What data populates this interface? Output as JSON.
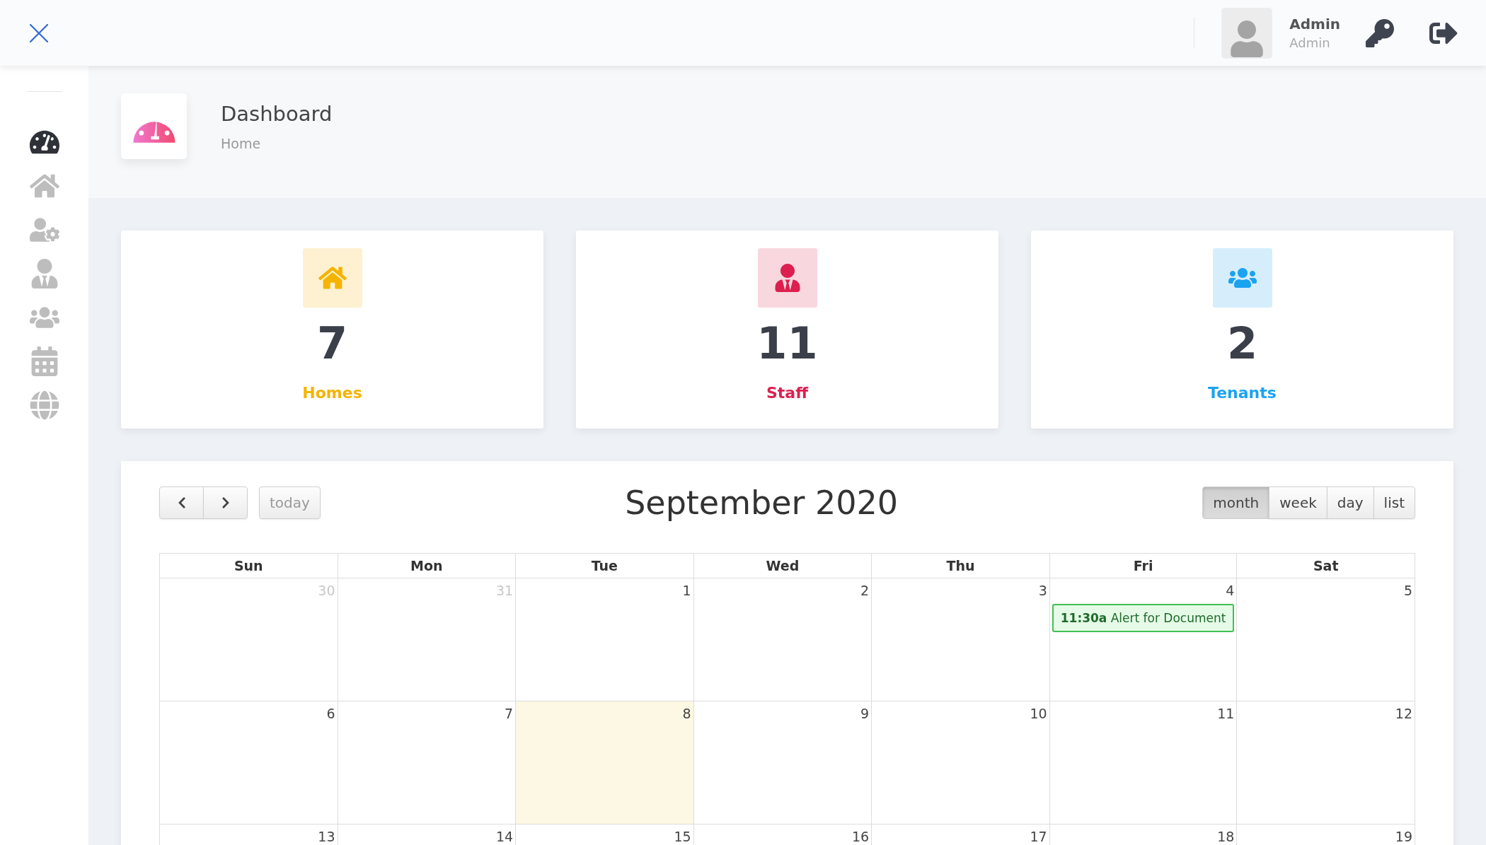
{
  "topbar": {
    "user_name": "Admin",
    "user_role": "Admin"
  },
  "sidebar": {
    "items": [
      {
        "kind": "dashboard",
        "selected": true
      },
      {
        "kind": "homes",
        "selected": false
      },
      {
        "kind": "user-settings",
        "selected": false
      },
      {
        "kind": "staff",
        "selected": false
      },
      {
        "kind": "tenants",
        "selected": false
      },
      {
        "kind": "calendar",
        "selected": false
      },
      {
        "kind": "globe",
        "selected": false
      }
    ]
  },
  "page_header": {
    "title": "Dashboard",
    "breadcrumb": "Home"
  },
  "stats": [
    {
      "kind": "homes",
      "value": "7",
      "label": "Homes",
      "color": "#f5b400"
    },
    {
      "kind": "staff",
      "value": "11",
      "label": "Staff",
      "color": "#dc1f4f"
    },
    {
      "kind": "tenants",
      "value": "2",
      "label": "Tenants",
      "color": "#1ba3f0"
    }
  ],
  "calendar": {
    "title": "September 2020",
    "today_button": "today",
    "views": [
      {
        "label": "month",
        "selected": true
      },
      {
        "label": "week",
        "selected": false
      },
      {
        "label": "day",
        "selected": false
      },
      {
        "label": "list",
        "selected": false
      }
    ],
    "weekdays": [
      "Sun",
      "Mon",
      "Tue",
      "Wed",
      "Thu",
      "Fri",
      "Sat"
    ],
    "weeks": [
      [
        {
          "day": "30",
          "other_month": true,
          "today": false
        },
        {
          "day": "31",
          "other_month": true,
          "today": false
        },
        {
          "day": "1",
          "other_month": false,
          "today": false
        },
        {
          "day": "2",
          "other_month": false,
          "today": false
        },
        {
          "day": "3",
          "other_month": false,
          "today": false
        },
        {
          "day": "4",
          "other_month": false,
          "today": false,
          "events": [
            {
              "time": "11:30a",
              "title": "Alert for Document"
            }
          ]
        },
        {
          "day": "5",
          "other_month": false,
          "today": false
        }
      ],
      [
        {
          "day": "6",
          "other_month": false,
          "today": false
        },
        {
          "day": "7",
          "other_month": false,
          "today": false
        },
        {
          "day": "8",
          "other_month": false,
          "today": true
        },
        {
          "day": "9",
          "other_month": false,
          "today": false
        },
        {
          "day": "10",
          "other_month": false,
          "today": false
        },
        {
          "day": "11",
          "other_month": false,
          "today": false
        },
        {
          "day": "12",
          "other_month": false,
          "today": false
        }
      ],
      [
        {
          "day": "13",
          "other_month": false,
          "today": false
        },
        {
          "day": "14",
          "other_month": false,
          "today": false
        },
        {
          "day": "15",
          "other_month": false,
          "today": false
        },
        {
          "day": "16",
          "other_month": false,
          "today": false
        },
        {
          "day": "17",
          "other_month": false,
          "today": false
        },
        {
          "day": "18",
          "other_month": false,
          "today": false
        },
        {
          "day": "19",
          "other_month": false,
          "today": false
        }
      ]
    ]
  }
}
